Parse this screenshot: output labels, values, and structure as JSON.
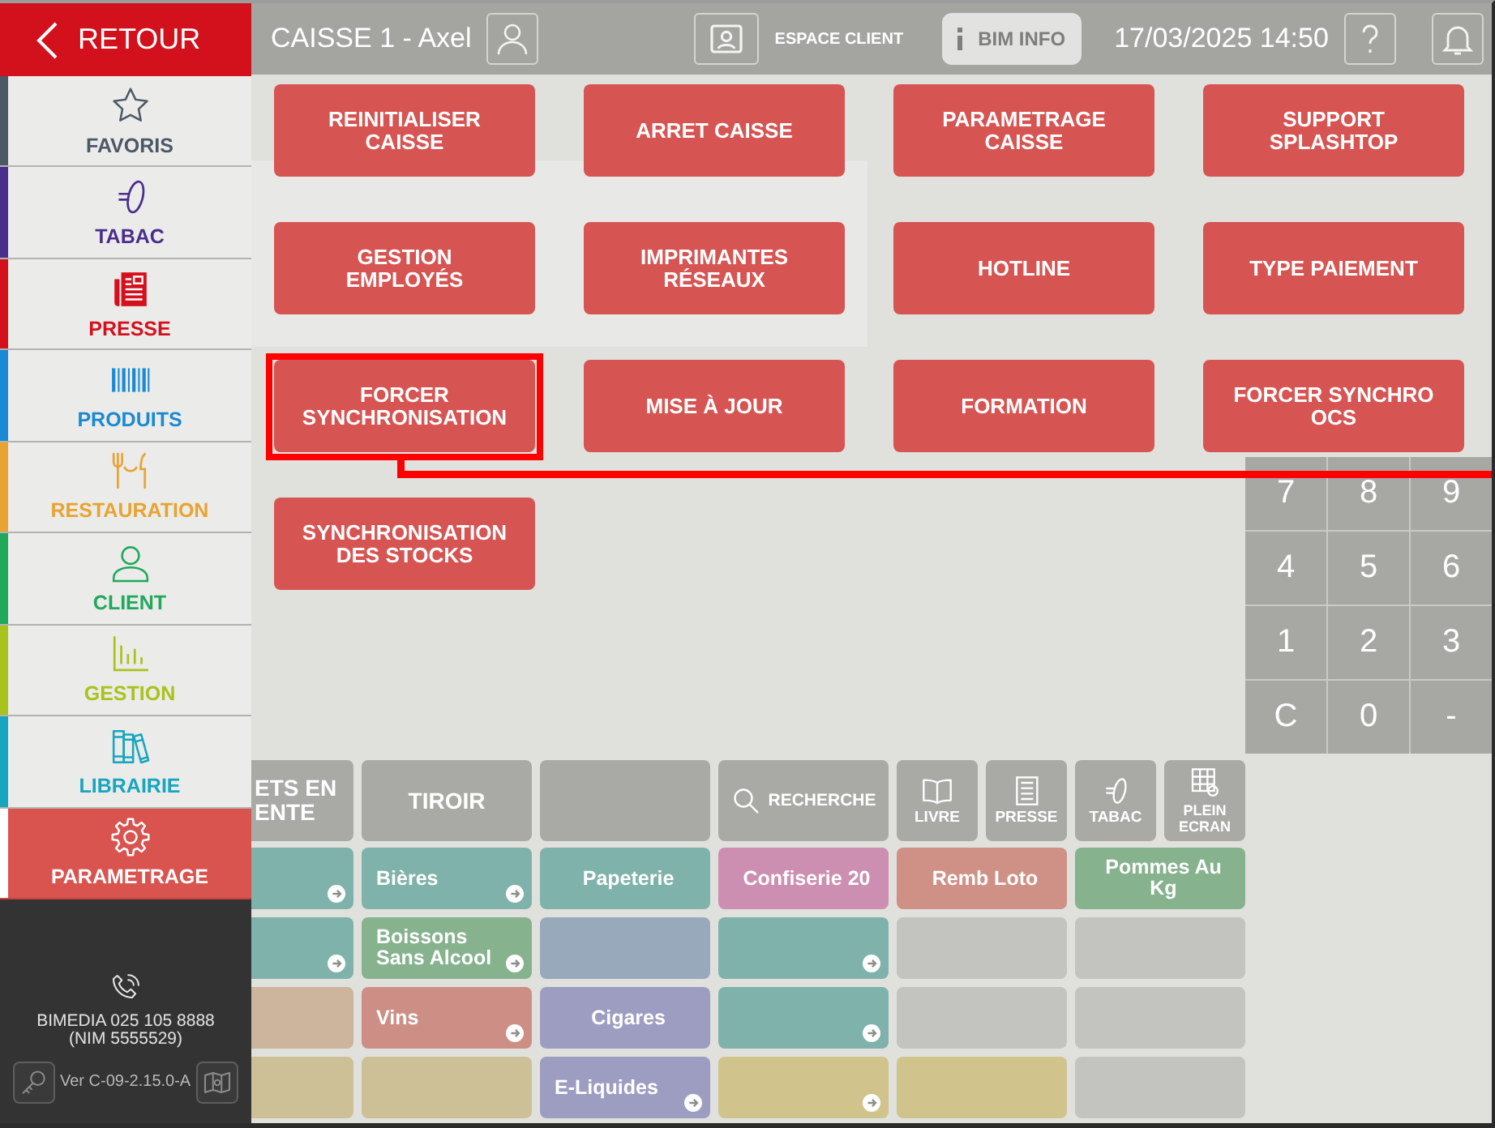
{
  "sidebar": {
    "back_button": {
      "label": "RETOUR"
    },
    "items": [
      {
        "label": "FAVORIS",
        "kind": "favorites",
        "color": "#4b5866",
        "selected": false
      },
      {
        "label": "TABAC",
        "kind": "tobacco",
        "color": "#4a2e8c",
        "selected": false
      },
      {
        "label": "PRESSE",
        "kind": "press",
        "color": "#d5101d",
        "selected": false
      },
      {
        "label": "PRODUITS",
        "kind": "products",
        "color": "#1b89d3",
        "selected": false
      },
      {
        "label": "RESTAURATION",
        "kind": "catering",
        "color": "#e9a330",
        "selected": false
      },
      {
        "label": "CLIENT",
        "kind": "client",
        "color": "#20a85c",
        "selected": false
      },
      {
        "label": "GESTION",
        "kind": "management",
        "color": "#a9c31c",
        "selected": false
      },
      {
        "label": "LIBRAIRIE",
        "kind": "library",
        "color": "#17a5bf",
        "selected": false
      },
      {
        "label": "PARAMETRAGE",
        "kind": "settings",
        "color": "#d9534f",
        "selected": true
      }
    ],
    "footer": {
      "contact": "BIMEDIA 025 105 8888",
      "nim": "(NIM 5555529)",
      "version": "Ver C-09-2.15.0-A"
    }
  },
  "register": {
    "header": {
      "title": "CAISSE 1 - Axel",
      "customer_space": "ESPACE CLIENT",
      "info_button": "BIM INFO",
      "datetime": "17/03/2025 14:50"
    },
    "toolbar": [
      {
        "kind": "text",
        "label": "ETS EN ENTE"
      },
      {
        "kind": "text",
        "label": "TIROIR"
      },
      {
        "kind": "blank"
      },
      {
        "kind": "search",
        "label": "RECHERCHE"
      },
      {
        "kind": "book",
        "label": "LIVRE"
      },
      {
        "kind": "press",
        "label": "PRESSE"
      },
      {
        "kind": "tobacco",
        "label": "TABAC"
      },
      {
        "kind": "fullscreen",
        "label": "PLEIN ECRAN"
      }
    ],
    "product_rows": [
      [
        {
          "color": "#7fb2aa",
          "submenu": true
        },
        {
          "label": "Bières",
          "color": "#7fb2aa",
          "submenu": true
        },
        {
          "label": "Papeterie",
          "color": "#7fb2aa",
          "submenu": false
        },
        {
          "label": "Confiserie 20",
          "color": "#cc8fb1",
          "submenu": false
        },
        {
          "label": "Remb Loto",
          "color": "#cf9186",
          "submenu": false
        },
        {
          "label": "Pommes Au Kg",
          "color": "#86b28e",
          "submenu": false
        }
      ],
      [
        {
          "color": "#7fb2aa",
          "submenu": true
        },
        {
          "label": "Boissons Sans Alcool",
          "color": "#86b28e",
          "submenu": true
        },
        {
          "color": "#97a9bb",
          "submenu": false
        },
        {
          "color": "#7fb2aa",
          "submenu": true
        },
        {
          "color": "#c3c4c0",
          "submenu": false
        },
        {
          "color": "#c3c4c0",
          "submenu": false
        }
      ],
      [
        {
          "color": "#cdb49c",
          "submenu": false
        },
        {
          "label": "Vins",
          "color": "#cd8f85",
          "submenu": true
        },
        {
          "label": "Cigares",
          "color": "#9d9dc1",
          "submenu": false
        },
        {
          "color": "#7fb2aa",
          "submenu": true
        },
        {
          "color": "#c3c4c0",
          "submenu": false
        },
        {
          "color": "#c3c4c0",
          "submenu": false
        }
      ],
      [
        {
          "color": "#cdc097",
          "submenu": false
        },
        {
          "color": "#cdc097",
          "submenu": false
        },
        {
          "label": "E-Liquides",
          "color": "#9d9dc1",
          "submenu": true
        },
        {
          "color": "#d0c38b",
          "submenu": true
        },
        {
          "color": "#d0c38b",
          "submenu": false
        },
        {
          "color": "#c3c4c0",
          "submenu": false
        }
      ]
    ],
    "keypad": [
      "7",
      "8",
      "9",
      "4",
      "5",
      "6",
      "1",
      "2",
      "3",
      "C",
      "0",
      "-"
    ]
  },
  "settings_menu": {
    "buttons": [
      {
        "label": "REINITIALISER CAISSE",
        "highlighted": false
      },
      {
        "label": "ARRET CAISSE",
        "highlighted": false
      },
      {
        "label": "PARAMETRAGE CAISSE",
        "highlighted": false
      },
      {
        "label": "SUPPORT SPLASHTOP",
        "highlighted": false
      },
      {
        "label": "GESTION EMPLOYÉS",
        "highlighted": false
      },
      {
        "label": "IMPRIMANTES RÉSEAUX",
        "highlighted": false
      },
      {
        "label": "HOTLINE",
        "highlighted": false
      },
      {
        "label": "TYPE PAIEMENT",
        "highlighted": false
      },
      {
        "label": "FORCER SYNCHRONISATION",
        "highlighted": true
      },
      {
        "label": "MISE À JOUR",
        "highlighted": false
      },
      {
        "label": "FORMATION",
        "highlighted": false
      },
      {
        "label": "FORCER SYNCHRO OCS",
        "highlighted": false
      },
      {
        "label": "SYNCHRONISATION DES STOCKS",
        "highlighted": false
      }
    ]
  }
}
